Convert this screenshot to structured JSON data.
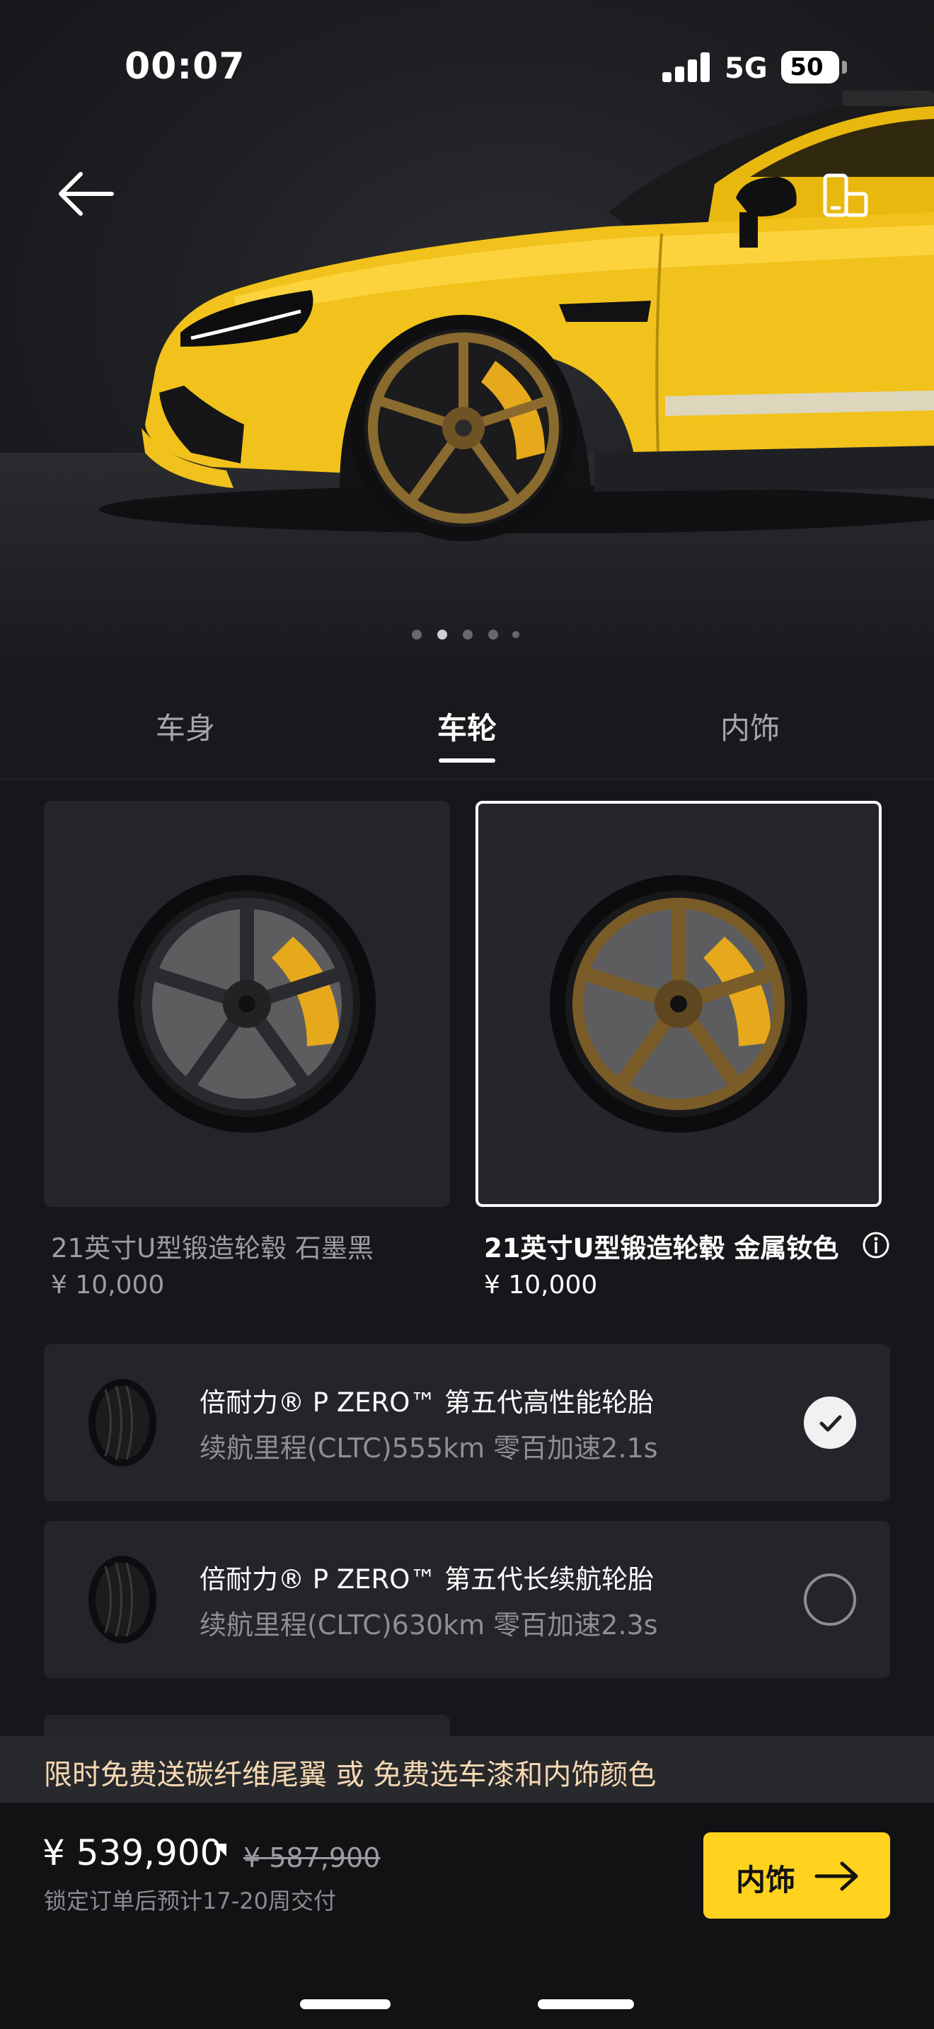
{
  "status_bar": {
    "time": "00:07",
    "network": "5G",
    "battery": "50"
  },
  "hero": {
    "icons": {
      "back": "arrow-left-icon",
      "mirror": "phone-rotate-icon"
    },
    "body_color": "#f1c21b",
    "rim_color": "#8a6a2e",
    "pager": {
      "count": 5,
      "active_index": 1
    }
  },
  "tabs": [
    {
      "label": "车身",
      "active": false
    },
    {
      "label": "车轮",
      "active": true
    },
    {
      "label": "内饰",
      "active": false
    }
  ],
  "wheels": [
    {
      "name": "21英寸U型锻造轮毂 石墨黑",
      "price": "¥ 10,000",
      "selected": false,
      "rim_color": "#2a2b2e"
    },
    {
      "name": "21英寸U型锻造轮毂 金属钕色",
      "price": "¥ 10,000",
      "selected": true,
      "rim_color": "#7a5c28"
    }
  ],
  "tires": [
    {
      "title": "倍耐力® P ZERO™ 第五代高性能轮胎",
      "subtitle": "续航里程(CLTC)555km 零百加速2.1s",
      "checked": true
    },
    {
      "title": "倍耐力® P ZERO™ 第五代长续航轮胎",
      "subtitle": "续航里程(CLTC)630km 零百加速2.3s",
      "checked": false
    }
  ],
  "promo": {
    "text": "限时免费送碳纤维尾翼 或 免费选车漆和内饰颜色"
  },
  "footer": {
    "price": "¥ 539,900",
    "old_price": "¥ 587,900",
    "delivery": "锁定订单后预计17-20周交付",
    "cta_label": "内饰",
    "accent": "#ffd21e"
  }
}
